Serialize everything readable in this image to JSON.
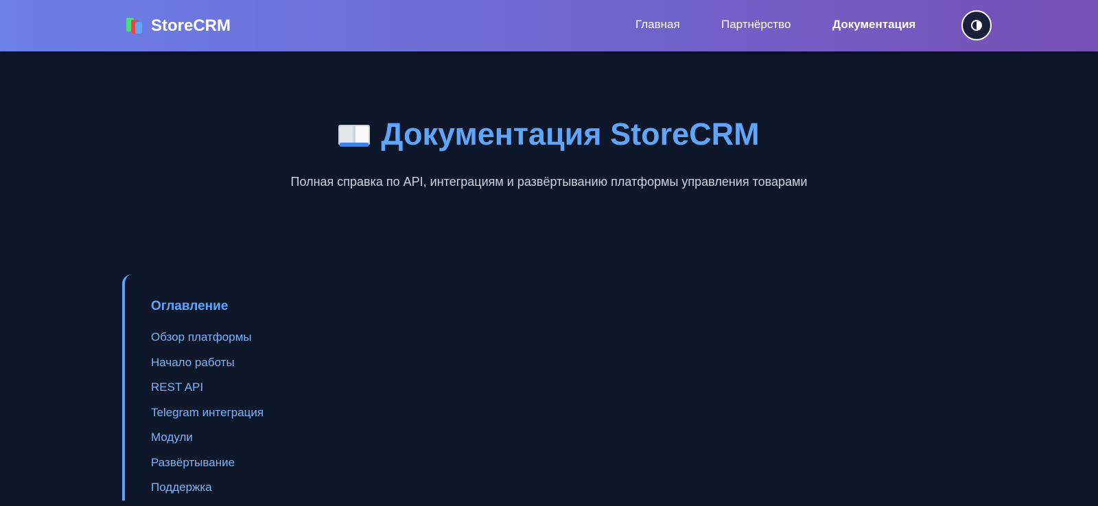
{
  "header": {
    "brand": "StoreCRM",
    "brand_icon": "books-icon",
    "nav": {
      "home": "Главная",
      "partnership": "Партнёрство",
      "docs": "Документация"
    },
    "active_nav": "docs",
    "theme_toggle_icon": "half-circle-contrast-icon",
    "gradient_colors": [
      "#6b80e8",
      "#7650b4"
    ]
  },
  "hero": {
    "icon": "open-book-icon",
    "title": "Документация StoreCRM",
    "subtitle": "Полная справка по API, интеграциям и развёртыванию платформы управления товарами"
  },
  "toc": {
    "title": "Оглавление",
    "items": [
      "Обзор платформы",
      "Начало работы",
      "REST API",
      "Telegram интеграция",
      "Модули",
      "Развёртывание",
      "Поддержка"
    ]
  },
  "colors": {
    "background": "#0f172a",
    "accent": "#60a5fa",
    "link": "#7fb3f5"
  }
}
